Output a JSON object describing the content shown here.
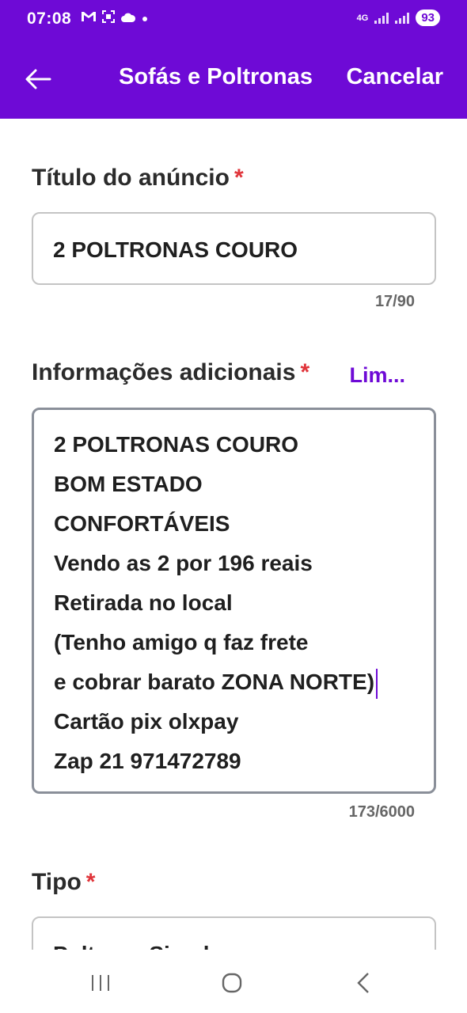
{
  "status_bar": {
    "time": "07:08",
    "left_icons": [
      "gmail-icon",
      "screenshot-icon",
      "cloud-icon",
      "dot-icon"
    ],
    "network": "4G",
    "battery": "93"
  },
  "app_bar": {
    "title": "Sofás e Poltronas",
    "cancel_label": "Cancelar",
    "background_color": "#6e0ad6"
  },
  "form": {
    "title_field": {
      "label": "Título do anúncio",
      "required_mark": "*",
      "value": "2 POLTRONAS COURO",
      "counter": "17/90"
    },
    "info_field": {
      "label": "Informações adicionais",
      "required_mark": "*",
      "clear_label": "Lim...",
      "lines": [
        "2 POLTRONAS COURO",
        "BOM ESTADO",
        "CONFORTÁVEIS",
        "Vendo as 2 por 196 reais",
        "Retirada no local",
        "(Tenho amigo q faz frete",
        "e cobrar barato ZONA NORTE)",
        "Cartão pix olxpay",
        "Zap 21 971472789"
      ],
      "counter": "173/6000"
    },
    "type_field": {
      "label": "Tipo",
      "required_mark": "*",
      "value": "Poltrona Simples"
    }
  },
  "colors": {
    "accent": "#6e0ad6",
    "required": "#e0343a"
  }
}
